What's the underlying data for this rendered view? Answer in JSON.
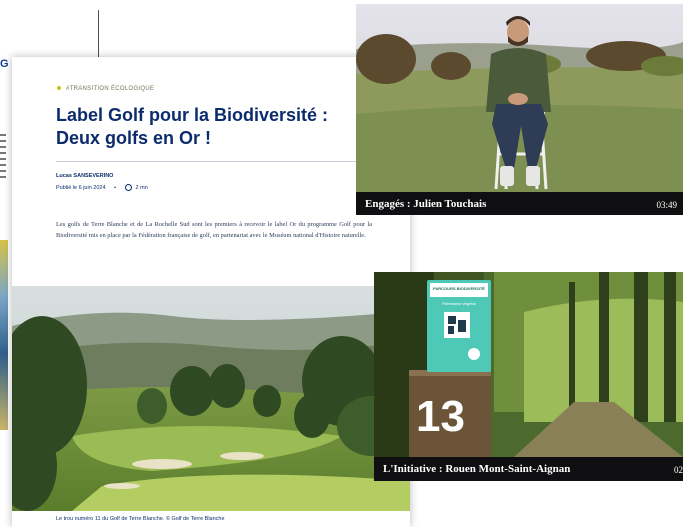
{
  "background_page": {
    "logo_fragment": "G"
  },
  "article": {
    "tag": "#TRANSITION ÉCOLOGIQUE",
    "title": "Label Golf pour la Biodiversité : Deux golfs en Or !",
    "author": "Lucas SANSEVERINO",
    "published": "Publié le 6 juin 2024",
    "read_time": "2 mn",
    "lead": "Les golfs de Terre Blanche et de La Rochelle Sud sont les premiers à recevoir le label Or du programme Golf pour la Biodiversité mis en place par la Fédération française de golf, en partenariat avec le Muséum national d'Histoire naturelle.",
    "photo_caption": "Le trou numéro 11 du Golf de Terre Blanche. © Golf de Terre Blanche",
    "accent_color": "#0d2c6c",
    "tag_dot_color": "#c8c21a"
  },
  "videos": [
    {
      "title": "Engagés : Julien Touchais",
      "duration": "03:49"
    },
    {
      "title": "L'Initiative : Rouen Mont-Saint-Aignan",
      "duration": "02",
      "sign_label": "PARCOURS BIODIVERSITÉ",
      "sign_sub": "Patrimoine végétal",
      "post_number": "13"
    }
  ]
}
